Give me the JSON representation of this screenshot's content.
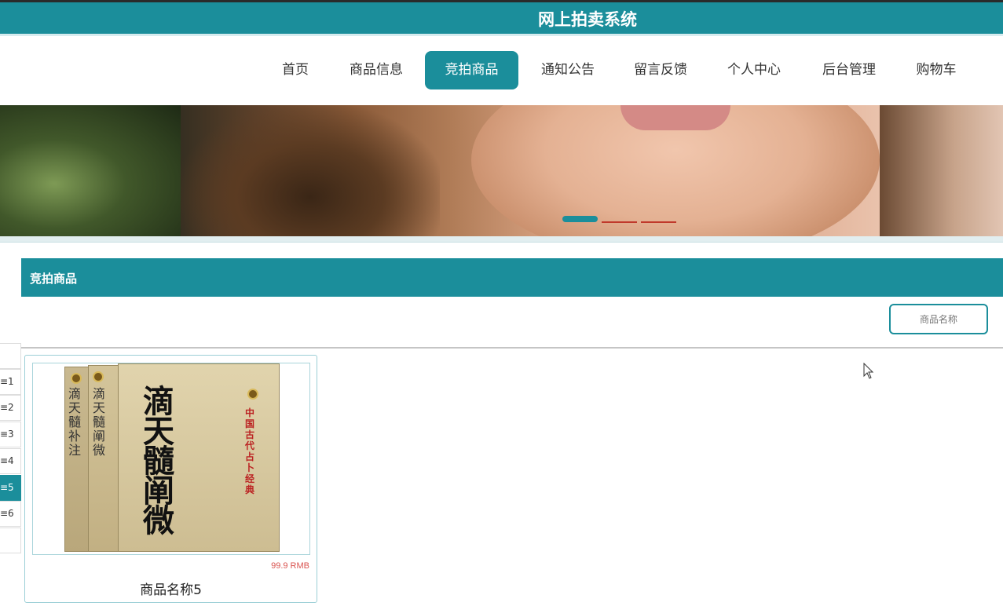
{
  "header": {
    "site_title": "网上拍卖系统"
  },
  "nav": {
    "items": [
      {
        "label": "首页"
      },
      {
        "label": "商品信息"
      },
      {
        "label": "竞拍商品"
      },
      {
        "label": "通知公告"
      },
      {
        "label": "留言反馈"
      },
      {
        "label": "个人中心"
      },
      {
        "label": "后台管理"
      },
      {
        "label": "购物车"
      }
    ],
    "active": "竞拍商品"
  },
  "banner": {
    "slide_count": 3,
    "active_slide": 1
  },
  "section": {
    "title": "竞拍商品"
  },
  "search": {
    "placeholder": "商品名称"
  },
  "pager": {
    "items": [
      "",
      "≡1",
      "≡2",
      "≡3",
      "≡4",
      "≡5",
      "≡6",
      ""
    ],
    "active_index": 5
  },
  "products": [
    {
      "name": "商品名称5",
      "price": "99.9 RMB",
      "cover_title": "滴天髓阐微",
      "cover_subtitle": "中国古代占卜经典",
      "spine_title_1": "滴天髓补注",
      "spine_title_2": "滴天髓阐微"
    }
  ],
  "colors": {
    "accent": "#1b8e9b",
    "price": "#d9534f"
  }
}
